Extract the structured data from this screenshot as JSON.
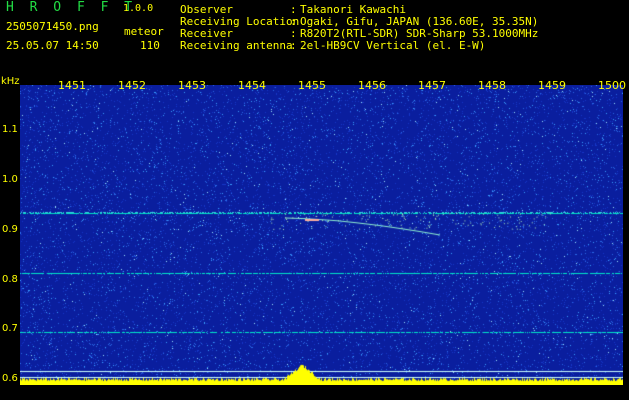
{
  "app": {
    "title": "H R O F F T",
    "version": "1.0.0"
  },
  "capture": {
    "file_name": "2505071450.png",
    "category": "meteor",
    "date_time": "25.05.07 14:50",
    "count": "110"
  },
  "info": [
    {
      "label": "Observer",
      "sep": ":",
      "value": "Takanori Kawachi"
    },
    {
      "label": "Receiving Location",
      "sep": ":",
      "value": "Ogaki, Gifu, JAPAN (136.60E, 35.35N)"
    },
    {
      "label": "Receiver",
      "sep": ":",
      "value": "R820T2(RTL-SDR) SDR-Sharp 53.1000MHz"
    },
    {
      "label": "Receiving antenna",
      "sep": ":",
      "value": "2el-HB9CV Vertical (el. E-W)"
    }
  ],
  "spectrogram": {
    "y_unit": "kHz",
    "y_ticks": [
      "1.1",
      "1.0",
      "0.9",
      "0.8",
      "0.7",
      "0.6"
    ],
    "x_ticks": [
      "1451",
      "1452",
      "1453",
      "1454",
      "1455",
      "1456",
      "1457",
      "1458",
      "1459",
      "1500"
    ],
    "colors": {
      "background": "#0a1e9e",
      "noise": "#3aa0ff",
      "line": "#00e8c8",
      "bar": "#ffff00"
    }
  }
}
